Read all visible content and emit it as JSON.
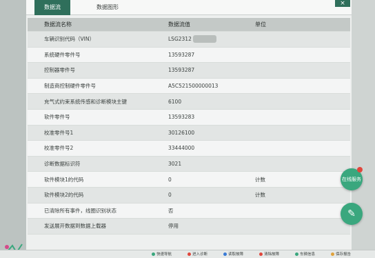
{
  "tabs": [
    {
      "label": "数据流"
    },
    {
      "label": "数据图形"
    }
  ],
  "window": {
    "close_label": "×"
  },
  "table": {
    "headers": {
      "name": "数据流名称",
      "value": "数据流值",
      "unit": "单位"
    },
    "rows": [
      {
        "name": "车辆识别代码（VIN）",
        "value": "LSG2312",
        "unit": ""
      },
      {
        "name": "系统硬件零件号",
        "value": "13593287",
        "unit": ""
      },
      {
        "name": "控制器零件号",
        "value": "13593287",
        "unit": ""
      },
      {
        "name": "制造商控制硬件零件号",
        "value": "A5C521500000013",
        "unit": ""
      },
      {
        "name": "充气式约束系统传感和诊断模块主键",
        "value": "6100",
        "unit": ""
      },
      {
        "name": "软件零件号",
        "value": "13593283",
        "unit": ""
      },
      {
        "name": "校准零件号1",
        "value": "30126100",
        "unit": ""
      },
      {
        "name": "校准零件号2",
        "value": "33444000",
        "unit": ""
      },
      {
        "name": "诊断数据标识符",
        "value": "3021",
        "unit": ""
      },
      {
        "name": "软件模块1的代码",
        "value": "0",
        "unit": "计数"
      },
      {
        "name": "软件模块2的代码",
        "value": "0",
        "unit": "计数"
      },
      {
        "name": "已清除所有事件，线圈识别状态",
        "value": "否",
        "unit": ""
      },
      {
        "name": "发送展开数据到数据上载器",
        "value": "停用",
        "unit": ""
      }
    ]
  },
  "fab": {
    "service_label": "在线服务",
    "edit_icon": "edit-icon",
    "service_icon": "chat-icon"
  },
  "taskbar": {
    "items": [
      "快速导航",
      "进入诊断",
      "读取故障",
      "清除故障",
      "车辆信息",
      "保存报告"
    ]
  },
  "colors": {
    "accent": "#2f6f5b",
    "fab": "#3aa77e",
    "badge": "#e0463c"
  }
}
